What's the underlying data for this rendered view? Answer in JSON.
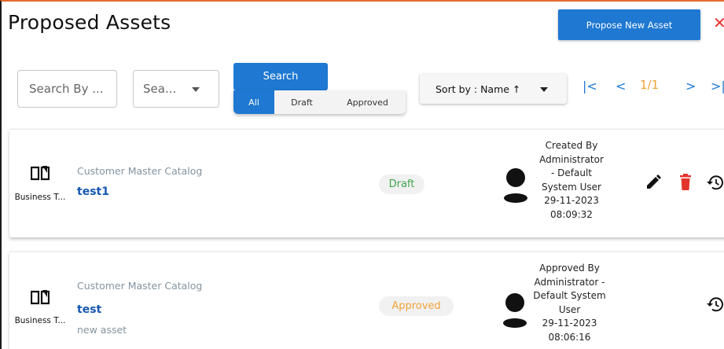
{
  "header": {
    "title": "Proposed Assets",
    "propose_label": "Propose New Asset",
    "close_glyph": "✕"
  },
  "search": {
    "input_placeholder": "Search By ...",
    "select_placeholder": "Sea...",
    "button_label": "Search"
  },
  "filters": [
    "All",
    "Draft",
    "Approved"
  ],
  "sort": {
    "label": "Sort by : Name ↑"
  },
  "pagination": {
    "first": "|<",
    "prev": "<",
    "page": "1/1",
    "next": ">",
    "last": ">|"
  },
  "assets": [
    {
      "type_label": "Business T...",
      "catalog": "Customer Master Catalog",
      "name": "test1",
      "description": "",
      "status": "Draft",
      "meta_lines": [
        "Created By",
        "Administrator",
        "- Default",
        "System User",
        "29-11-2023",
        "08:09:32"
      ]
    },
    {
      "type_label": "Business T...",
      "catalog": "Customer Master Catalog",
      "name": "test",
      "description": "new asset",
      "status": "Approved",
      "meta_lines": [
        "Approved By",
        "Administrator -",
        "Default System",
        "User",
        "29-11-2023",
        "08:06:16"
      ]
    }
  ],
  "colors": {
    "primary": "#1f78d1",
    "draft": "#3fa34d",
    "approved": "#f0a33a",
    "danger": "#e3352d",
    "accent_border": "#e56a2e"
  },
  "icons": [
    "close-icon",
    "caret-down-icon",
    "book-icon",
    "user-icon",
    "edit-icon",
    "delete-icon",
    "history-icon"
  ]
}
